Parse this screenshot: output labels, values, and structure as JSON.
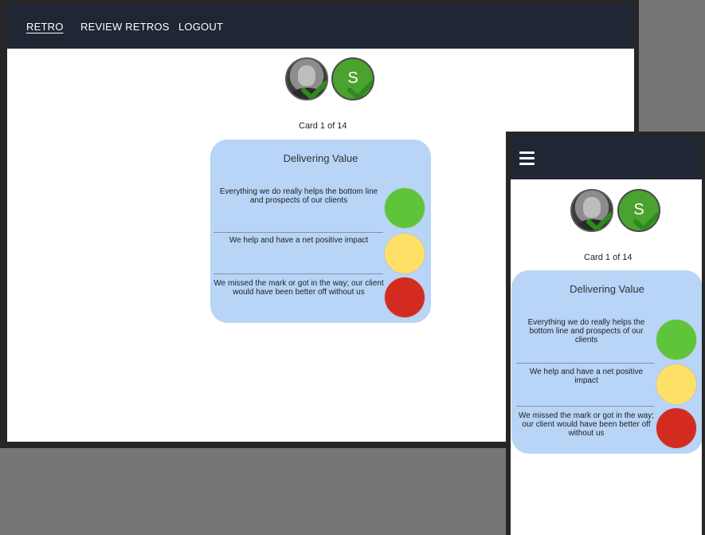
{
  "nav": {
    "links": [
      {
        "label": "RETRO",
        "active": true
      },
      {
        "label": "REVIEW RETROS",
        "active": false
      },
      {
        "label": "LOGOUT",
        "active": false
      }
    ]
  },
  "participants": [
    {
      "type": "photo",
      "initial": "",
      "checked": true
    },
    {
      "type": "initial",
      "initial": "S",
      "checked": true
    }
  ],
  "card_counter": "Card 1 of 14",
  "card": {
    "title": "Delivering Value",
    "options": [
      {
        "text": "Everything we do really helps the bottom line and prospects of our clients",
        "color": "#5ec43a",
        "rating": "green"
      },
      {
        "text": "We help and have a net positive impact",
        "color": "#ffe066",
        "rating": "yellow"
      },
      {
        "text": "We missed the mark or got in the way; our client would have been better off without us",
        "color": "#d42b20",
        "rating": "red"
      }
    ]
  },
  "colors": {
    "nav_bg": "#202634",
    "card_bg": "#b8d4f7",
    "check_green": "#2f8a1e",
    "avatar_green": "#4aa22f"
  },
  "icons": {
    "menu": "hamburger-menu-icon",
    "check": "check-icon"
  }
}
